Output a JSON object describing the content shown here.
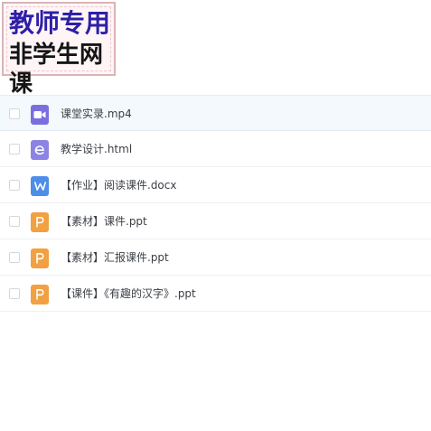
{
  "badge": {
    "line1": "教师专用",
    "line2": "非学生网课"
  },
  "colors": {
    "video": "#7b6fe0",
    "html": "#8c84e4",
    "word": "#4d8ee6",
    "ppt": "#f1a042"
  },
  "files": [
    {
      "name": "课堂实录.mp4",
      "icon": "video-file-icon",
      "type": "video"
    },
    {
      "name": "教学设计.html",
      "icon": "html-file-icon",
      "type": "html"
    },
    {
      "name": "【作业】阅读课件.docx",
      "icon": "word-file-icon",
      "type": "word"
    },
    {
      "name": "【素材】课件.ppt",
      "icon": "ppt-file-icon",
      "type": "ppt"
    },
    {
      "name": "【素材】汇报课件.ppt",
      "icon": "ppt-file-icon",
      "type": "ppt"
    },
    {
      "name": "【课件】《有趣的汉字》.ppt",
      "icon": "ppt-file-icon",
      "type": "ppt"
    }
  ]
}
